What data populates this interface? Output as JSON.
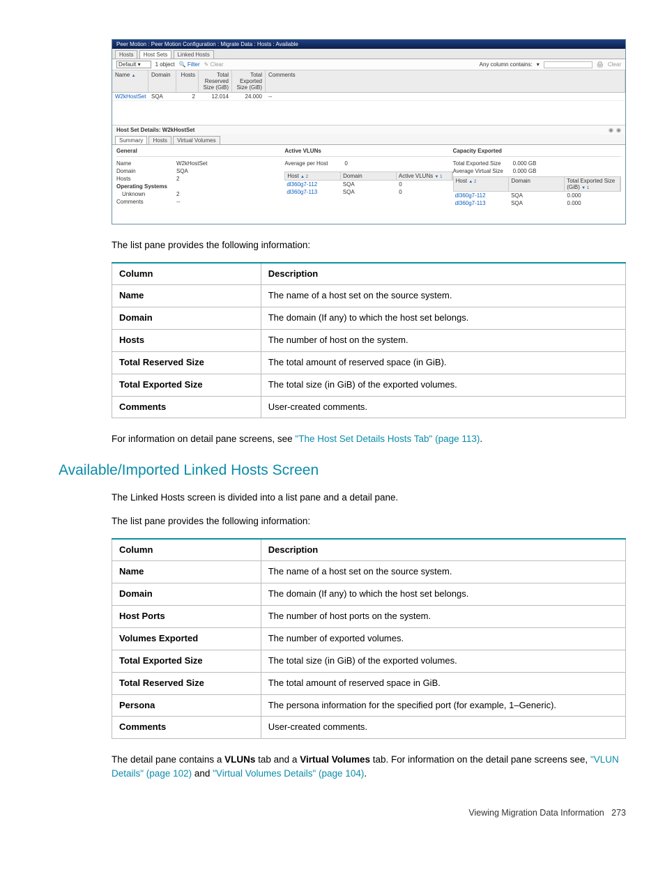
{
  "screenshot": {
    "title": "Peer Motion : Peer Motion Configuration : Migrate Data : Hosts : Available",
    "top_tabs": [
      "Hosts",
      "Host Sets",
      "Linked Hosts"
    ],
    "active_top_tab": "Host Sets",
    "select_value": "Default",
    "object_count": "1 object",
    "filter_label": "Filter",
    "clear_label": "Clear",
    "search_label": "Any column contains:",
    "print_icon": "print",
    "export_icon": "export",
    "columns": [
      "Name",
      "Domain",
      "Hosts",
      "Total Reserved Size (GiB)",
      "Total Exported Size (GiB)",
      "Comments"
    ],
    "row": {
      "name": "W2kHostSet",
      "domain": "SQA",
      "hosts": "2",
      "trs": "12.014",
      "tes": "24.000",
      "comments": "--"
    },
    "details_title": "Host Set Details: W2kHostSet",
    "sub_tabs": [
      "Summary",
      "Hosts",
      "Virtual Volumes"
    ],
    "active_sub_tab": "Summary",
    "general": {
      "header": "General",
      "name_k": "Name",
      "name_v": "W2kHostSet",
      "domain_k": "Domain",
      "domain_v": "SQA",
      "hosts_k": "Hosts",
      "hosts_v": "2",
      "os_k": "Operating Systems",
      "unknown_k": "Unknown",
      "unknown_v": "2",
      "comments_k": "Comments",
      "comments_v": "--"
    },
    "vluns": {
      "header": "Active VLUNs",
      "avg_k": "Average per Host",
      "avg_v": "0",
      "cols": [
        "Host",
        "Domain",
        "Active VLUNs"
      ],
      "rows": [
        {
          "host": "dl360g7-112",
          "domain": "SQA",
          "vluns": "0"
        },
        {
          "host": "dl360g7-113",
          "domain": "SQA",
          "vluns": "0"
        }
      ]
    },
    "capacity": {
      "header": "Capacity Exported",
      "tes_k": "Total Exported Size",
      "tes_v": "0.000 GB",
      "avs_k": "Average Virtual Size",
      "avs_v": "0.000 GB",
      "cols": [
        "Host",
        "Domain",
        "Total Exported Size (GiB)"
      ],
      "rows": [
        {
          "host": "dl360g7-112",
          "domain": "SQA",
          "size": "0.000"
        },
        {
          "host": "dl360g7-113",
          "domain": "SQA",
          "size": "0.000"
        }
      ]
    }
  },
  "doc": {
    "intro1": "The list pane provides the following information:",
    "table1_header_col": "Column",
    "table1_header_desc": "Description",
    "table1": [
      {
        "c": "Name",
        "d": "The name of a host set on the source system."
      },
      {
        "c": "Domain",
        "d": "The domain (If any) to which the host set belongs."
      },
      {
        "c": "Hosts",
        "d": "The number of host on the system."
      },
      {
        "c": "Total Reserved Size",
        "d": "The total amount of reserved space (in GiB)."
      },
      {
        "c": "Total Exported Size",
        "d": "The total size (in GiB) of the exported volumes."
      },
      {
        "c": "Comments",
        "d": "User-created comments."
      }
    ],
    "post1_prefix": "For information on detail pane screens, see ",
    "post1_link": "\"The Host Set Details Hosts Tab\" (page 113)",
    "post1_suffix": ".",
    "section_heading": "Available/Imported Linked Hosts Screen",
    "body1": "The Linked Hosts screen is divided into a list pane and a detail pane.",
    "body2": "The list pane provides the following information:",
    "table2": [
      {
        "c": "Name",
        "d": "The name of a host set on the source system."
      },
      {
        "c": "Domain",
        "d": "The domain (If any) to which the host set belongs."
      },
      {
        "c": "Host Ports",
        "d": "The number of host ports on the system."
      },
      {
        "c": "Volumes Exported",
        "d": "The number of exported volumes."
      },
      {
        "c": "Total Exported Size",
        "d": "The total size (in GiB) of the exported volumes."
      },
      {
        "c": "Total Reserved Size",
        "d": "The total amount of reserved space in GiB."
      },
      {
        "c": "Persona",
        "d": "The persona information for the specified port (for example, 1–Generic)."
      },
      {
        "c": "Comments",
        "d": "User-created comments."
      }
    ],
    "outro_prefix": "The detail pane contains a ",
    "outro_bold1": "VLUNs",
    "outro_mid1": " tab and a ",
    "outro_bold2": "Virtual Volumes",
    "outro_mid2": " tab. For information on the detail pane screens see, ",
    "outro_link1": "\"VLUN Details\" (page 102)",
    "outro_mid3": " and ",
    "outro_link2": "\"Virtual Volumes Details\" (page 104)",
    "outro_suffix": "."
  },
  "footer": {
    "text": "Viewing Migration Data Information",
    "page": "273"
  }
}
